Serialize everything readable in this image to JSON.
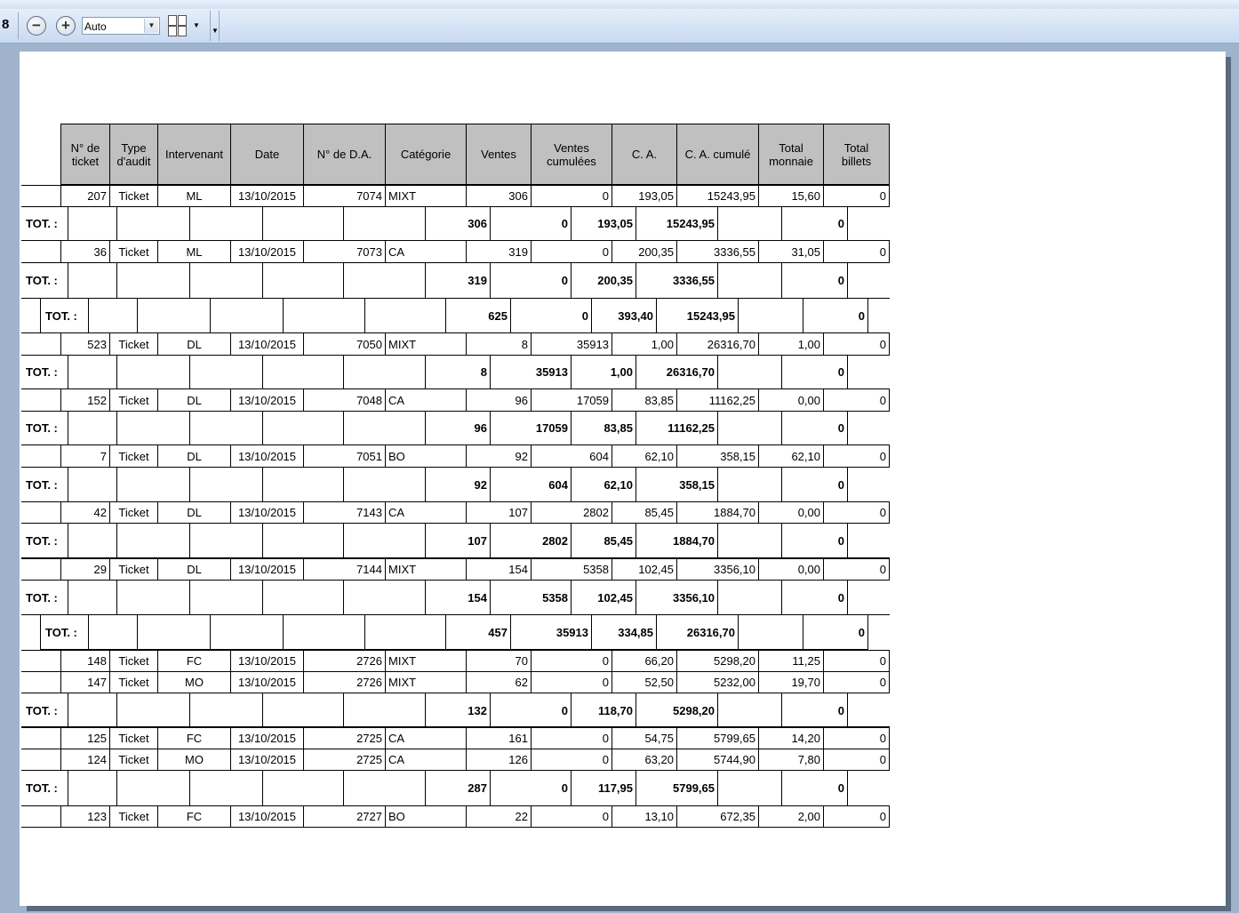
{
  "toolbar": {
    "page_number": "8",
    "zoom_value": "Auto"
  },
  "report": {
    "headers": [
      "N° de\nticket",
      "Type\nd'audit",
      "Intervenant",
      "Date",
      "N° de D.A.",
      "Catégorie",
      "Ventes",
      "Ventes\ncumulées",
      "C. A.",
      "C. A. cumulé",
      "Total\nmonnaie",
      "Total\nbillets"
    ],
    "total_label": "TOT. :",
    "rows": [
      {
        "kind": "data",
        "cells": [
          "207",
          "Ticket",
          "ML",
          "13/10/2015",
          "7074",
          "MIXT",
          "306",
          "0",
          "193,05",
          "15243,95",
          "15,60",
          "0"
        ]
      },
      {
        "kind": "total",
        "cells": [
          "306",
          "0",
          "193,05",
          "15243,95",
          "0"
        ]
      },
      {
        "kind": "data",
        "cells": [
          "36",
          "Ticket",
          "ML",
          "13/10/2015",
          "7073",
          "CA",
          "319",
          "0",
          "200,35",
          "3336,55",
          "31,05",
          "0"
        ]
      },
      {
        "kind": "total",
        "cells": [
          "319",
          "0",
          "200,35",
          "3336,55",
          "0"
        ]
      },
      {
        "kind": "grand",
        "cells": [
          "625",
          "0",
          "393,40",
          "15243,95",
          "0"
        ]
      },
      {
        "kind": "data",
        "cells": [
          "523",
          "Ticket",
          "DL",
          "13/10/2015",
          "7050",
          "MIXT",
          "8",
          "35913",
          "1,00",
          "26316,70",
          "1,00",
          "0"
        ]
      },
      {
        "kind": "total",
        "cells": [
          "8",
          "35913",
          "1,00",
          "26316,70",
          "0"
        ]
      },
      {
        "kind": "data",
        "cells": [
          "152",
          "Ticket",
          "DL",
          "13/10/2015",
          "7048",
          "CA",
          "96",
          "17059",
          "83,85",
          "11162,25",
          "0,00",
          "0"
        ]
      },
      {
        "kind": "total",
        "cells": [
          "96",
          "17059",
          "83,85",
          "11162,25",
          "0"
        ]
      },
      {
        "kind": "data",
        "cells": [
          "7",
          "Ticket",
          "DL",
          "13/10/2015",
          "7051",
          "BO",
          "92",
          "604",
          "62,10",
          "358,15",
          "62,10",
          "0"
        ]
      },
      {
        "kind": "total",
        "cells": [
          "92",
          "604",
          "62,10",
          "358,15",
          "0"
        ]
      },
      {
        "kind": "data",
        "cells": [
          "42",
          "Ticket",
          "DL",
          "13/10/2015",
          "7143",
          "CA",
          "107",
          "2802",
          "85,45",
          "1884,70",
          "0,00",
          "0"
        ]
      },
      {
        "kind": "total",
        "cells": [
          "107",
          "2802",
          "85,45",
          "1884,70",
          "0"
        ]
      },
      {
        "kind": "data",
        "cells": [
          "29",
          "Ticket",
          "DL",
          "13/10/2015",
          "7144",
          "MIXT",
          "154",
          "5358",
          "102,45",
          "3356,10",
          "0,00",
          "0"
        ]
      },
      {
        "kind": "total",
        "cells": [
          "154",
          "5358",
          "102,45",
          "3356,10",
          "0"
        ]
      },
      {
        "kind": "grand",
        "cells": [
          "457",
          "35913",
          "334,85",
          "26316,70",
          "0"
        ]
      },
      {
        "kind": "data",
        "cells": [
          "148",
          "Ticket",
          "FC",
          "13/10/2015",
          "2726",
          "MIXT",
          "70",
          "0",
          "66,20",
          "5298,20",
          "11,25",
          "0"
        ]
      },
      {
        "kind": "data",
        "cells": [
          "147",
          "Ticket",
          "MO",
          "13/10/2015",
          "2726",
          "MIXT",
          "62",
          "0",
          "52,50",
          "5232,00",
          "19,70",
          "0"
        ]
      },
      {
        "kind": "total",
        "cells": [
          "132",
          "0",
          "118,70",
          "5298,20",
          "0"
        ]
      },
      {
        "kind": "data",
        "cells": [
          "125",
          "Ticket",
          "FC",
          "13/10/2015",
          "2725",
          "CA",
          "161",
          "0",
          "54,75",
          "5799,65",
          "14,20",
          "0"
        ]
      },
      {
        "kind": "data",
        "cells": [
          "124",
          "Ticket",
          "MO",
          "13/10/2015",
          "2725",
          "CA",
          "126",
          "0",
          "63,20",
          "5744,90",
          "7,80",
          "0"
        ]
      },
      {
        "kind": "total",
        "cells": [
          "287",
          "0",
          "117,95",
          "5799,65",
          "0"
        ]
      },
      {
        "kind": "data",
        "cells": [
          "123",
          "Ticket",
          "FC",
          "13/10/2015",
          "2727",
          "BO",
          "22",
          "0",
          "13,10",
          "672,35",
          "2,00",
          "0"
        ]
      }
    ]
  }
}
